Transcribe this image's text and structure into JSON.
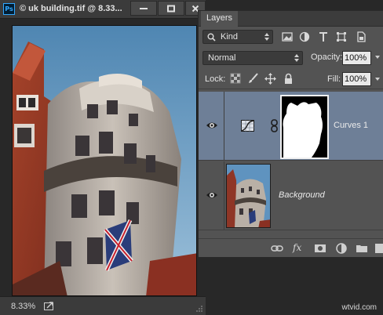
{
  "document": {
    "title": "© uk building.tif @ 8.33...",
    "app_badge": "Ps",
    "zoom": "8.33%"
  },
  "layers_panel": {
    "tab_label": "Layers",
    "filter_kind": "Kind",
    "blend_mode": "Normal",
    "opacity_label": "Opacity:",
    "opacity_value": "100%",
    "lock_label": "Lock:",
    "fill_label": "Fill:",
    "fill_value": "100%",
    "layers": [
      {
        "name": "Curves 1",
        "selected": true,
        "visible": true
      },
      {
        "name": "Background",
        "selected": false,
        "visible": true
      }
    ],
    "footer_fx": "fx"
  },
  "watermark": "wtvid.com",
  "colors": {
    "panel_bg": "#535353",
    "selected_layer": "#6e7f97",
    "ps_blue": "#31a8ff"
  }
}
